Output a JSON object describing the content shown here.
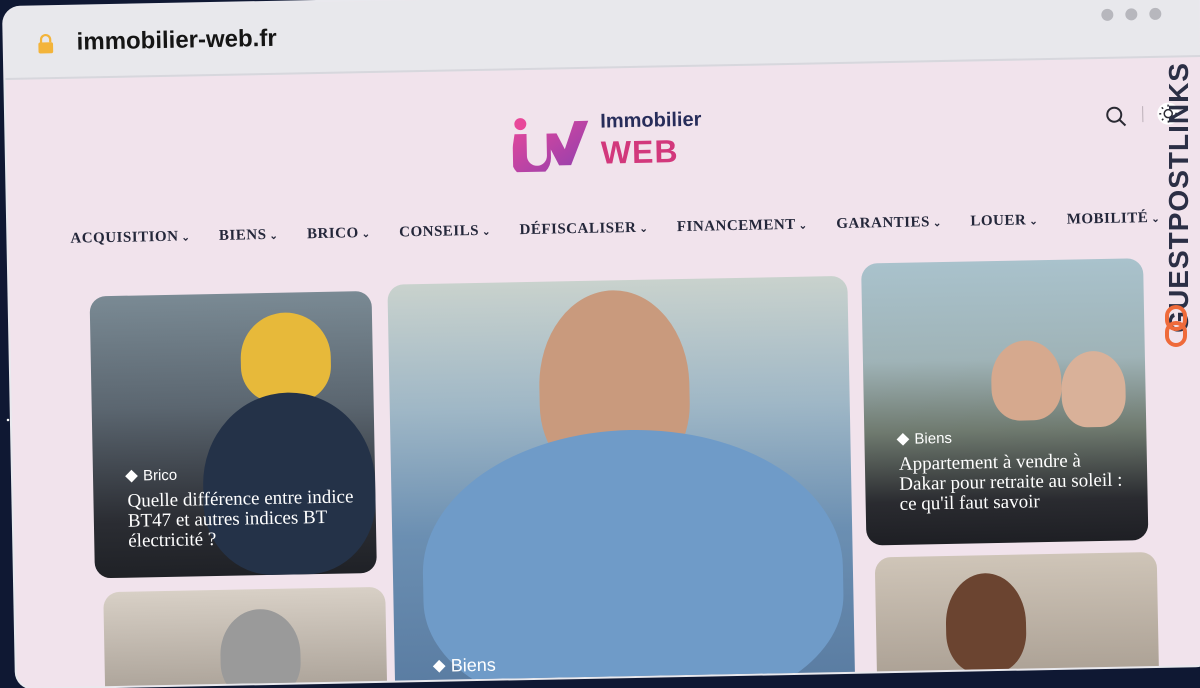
{
  "browser": {
    "url": "immobilier-web.fr"
  },
  "watermark": {
    "text": "GUESTPOSTLINKS"
  },
  "logo": {
    "line1": "Immobilier",
    "line2": "WEB"
  },
  "nav": {
    "items": [
      {
        "label": "ACQUISITION"
      },
      {
        "label": "BIENS"
      },
      {
        "label": "BRICO"
      },
      {
        "label": "CONSEILS"
      },
      {
        "label": "DÉFISCALISER"
      },
      {
        "label": "FINANCEMENT"
      },
      {
        "label": "GARANTIES"
      },
      {
        "label": "LOUER"
      },
      {
        "label": "MOBILITÉ"
      }
    ]
  },
  "cards": {
    "card1": {
      "tag": "Brico",
      "title": "Quelle différence entre indice BT47 et autres indices BT électricité ?"
    },
    "card2": {
      "tag": "Biens"
    },
    "card3": {
      "tag": "Biens",
      "title": "Appartement à vendre à Dakar pour retraite au soleil : ce qu'il faut savoir"
    }
  },
  "colors": {
    "page_bg": "#f1e3ec",
    "logo_pink": "#d2387c",
    "logo_navy": "#272d5a"
  }
}
